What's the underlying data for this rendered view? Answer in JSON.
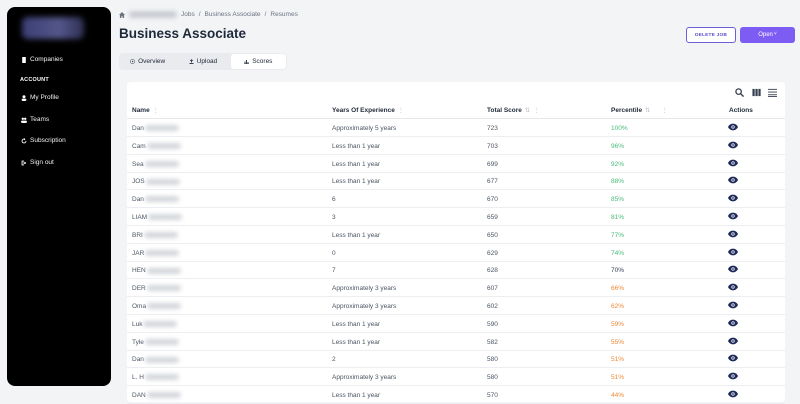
{
  "sidebar": {
    "items": [
      {
        "label": "Companies",
        "icon": "building-icon"
      },
      {
        "label": "My Profile",
        "icon": "user-icon"
      },
      {
        "label": "Teams",
        "icon": "users-icon"
      },
      {
        "label": "Subscription",
        "icon": "refresh-icon"
      },
      {
        "label": "Sign out",
        "icon": "sign-out-icon"
      }
    ],
    "section_heading": "ACCOUNT"
  },
  "breadcrumb": {
    "items": [
      "Jobs",
      "Business Associate",
      "Resumes"
    ],
    "separator": "/"
  },
  "page": {
    "title": "Business Associate"
  },
  "actions": {
    "delete_label": "DELETE JOB",
    "open_label": "Open"
  },
  "tabs": [
    {
      "label": "Overview",
      "icon": "circle-play-icon"
    },
    {
      "label": "Upload",
      "icon": "upload-icon"
    },
    {
      "label": "Scores",
      "icon": "bar-chart-icon"
    }
  ],
  "table": {
    "columns": [
      "Name",
      "Years Of Experience",
      "Total Score",
      "Percentile",
      "Actions"
    ],
    "rows": [
      {
        "name": "Dan",
        "years": "Approximately 5 years",
        "score": "723",
        "percentile": "100%",
        "pcolor": "#48bb78"
      },
      {
        "name": "Cam",
        "years": "Less than 1 year",
        "score": "703",
        "percentile": "96%",
        "pcolor": "#48bb78"
      },
      {
        "name": "Sea",
        "years": "Less than 1 year",
        "score": "699",
        "percentile": "92%",
        "pcolor": "#48bb78"
      },
      {
        "name": "JOS",
        "years": "Less than 1 year",
        "score": "677",
        "percentile": "88%",
        "pcolor": "#48bb78"
      },
      {
        "name": "Dan",
        "years": "6",
        "score": "670",
        "percentile": "85%",
        "pcolor": "#48bb78"
      },
      {
        "name": "LIAM",
        "years": "3",
        "score": "659",
        "percentile": "81%",
        "pcolor": "#48bb78"
      },
      {
        "name": "BRI",
        "years": "Less than 1 year",
        "score": "650",
        "percentile": "77%",
        "pcolor": "#48bb78"
      },
      {
        "name": "JAR",
        "years": "0",
        "score": "629",
        "percentile": "74%",
        "pcolor": "#48bb78"
      },
      {
        "name": "HEN",
        "years": "7",
        "score": "628",
        "percentile": "70%",
        "pcolor": "#374151"
      },
      {
        "name": "DER",
        "years": "Approximately 3 years",
        "score": "607",
        "percentile": "66%",
        "pcolor": "#ed8936"
      },
      {
        "name": "Oma",
        "years": "Approximately 3 years",
        "score": "602",
        "percentile": "62%",
        "pcolor": "#ed8936"
      },
      {
        "name": "Luk",
        "years": "Less than 1 year",
        "score": "590",
        "percentile": "59%",
        "pcolor": "#ed8936"
      },
      {
        "name": "Tyle",
        "years": "Less than 1 year",
        "score": "582",
        "percentile": "55%",
        "pcolor": "#ed8936"
      },
      {
        "name": "Dan",
        "years": "2",
        "score": "580",
        "percentile": "51%",
        "pcolor": "#ed8936"
      },
      {
        "name": "L. H",
        "years": "Approximately 3 years",
        "score": "580",
        "percentile": "51%",
        "pcolor": "#ed8936"
      },
      {
        "name": "DAN",
        "years": "Less than 1 year",
        "score": "570",
        "percentile": "44%",
        "pcolor": "#ed8936"
      }
    ]
  },
  "colors": {
    "accent": "#7c5cf3",
    "eye": "#1e2a5a"
  }
}
